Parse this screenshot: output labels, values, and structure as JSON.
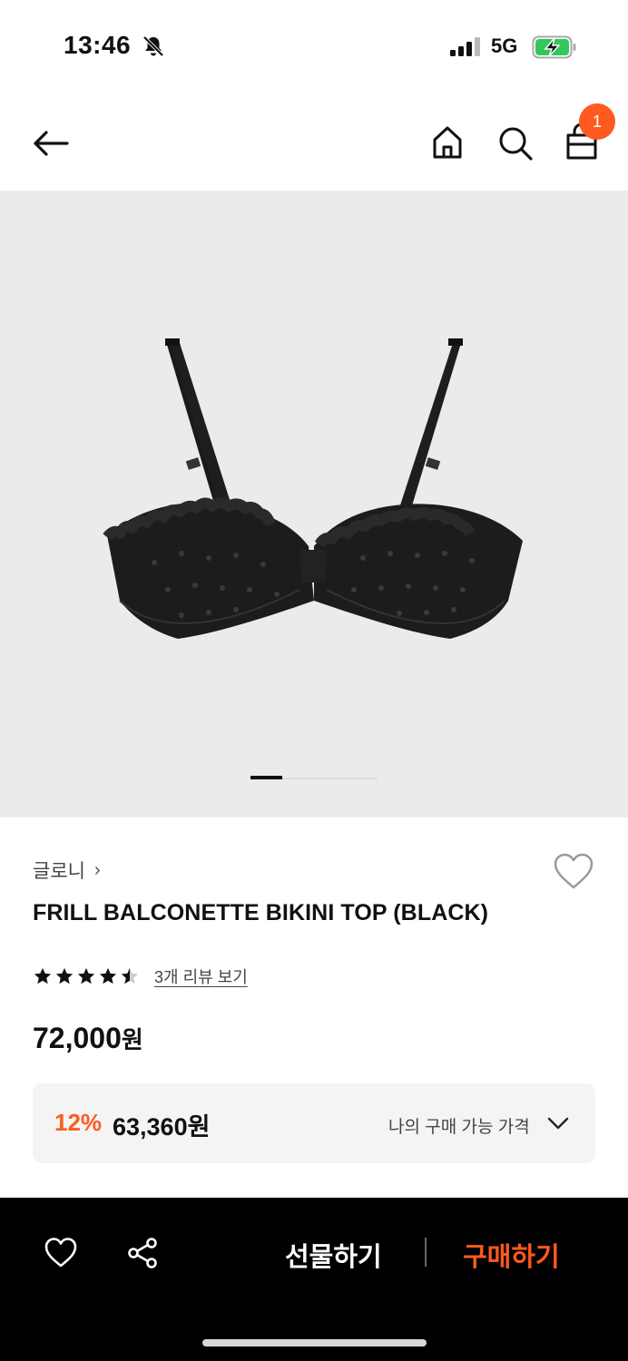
{
  "status": {
    "time": "13:46",
    "network": "5G"
  },
  "cart": {
    "badge_count": "1"
  },
  "product": {
    "brand": "글로니",
    "brand_chevron": "›",
    "title": "FRILL BALCONETTE BIKINI TOP (BLACK)",
    "rating": 4.5,
    "review_link": "3개 리뷰 보기",
    "price_value": "72,000",
    "price_unit": "원",
    "discount_rate": "12%",
    "discount_price": "63,360원",
    "my_price_label": "나의 구매 가능 가격"
  },
  "carousel": {
    "current": 1,
    "total": 4
  },
  "bottom_bar": {
    "gift_label": "선물하기",
    "buy_label": "구매하기"
  },
  "colors": {
    "accent": "#ff5a1f",
    "image_bg": "#ebebeb",
    "bar_bg": "#000000"
  },
  "icons": [
    "mute-bell-icon",
    "signal-icon",
    "battery-charging-icon",
    "back-arrow-icon",
    "home-icon",
    "search-icon",
    "shopping-bag-icon",
    "heart-outline-icon",
    "star-icon",
    "chevron-down-icon",
    "share-icon"
  ]
}
